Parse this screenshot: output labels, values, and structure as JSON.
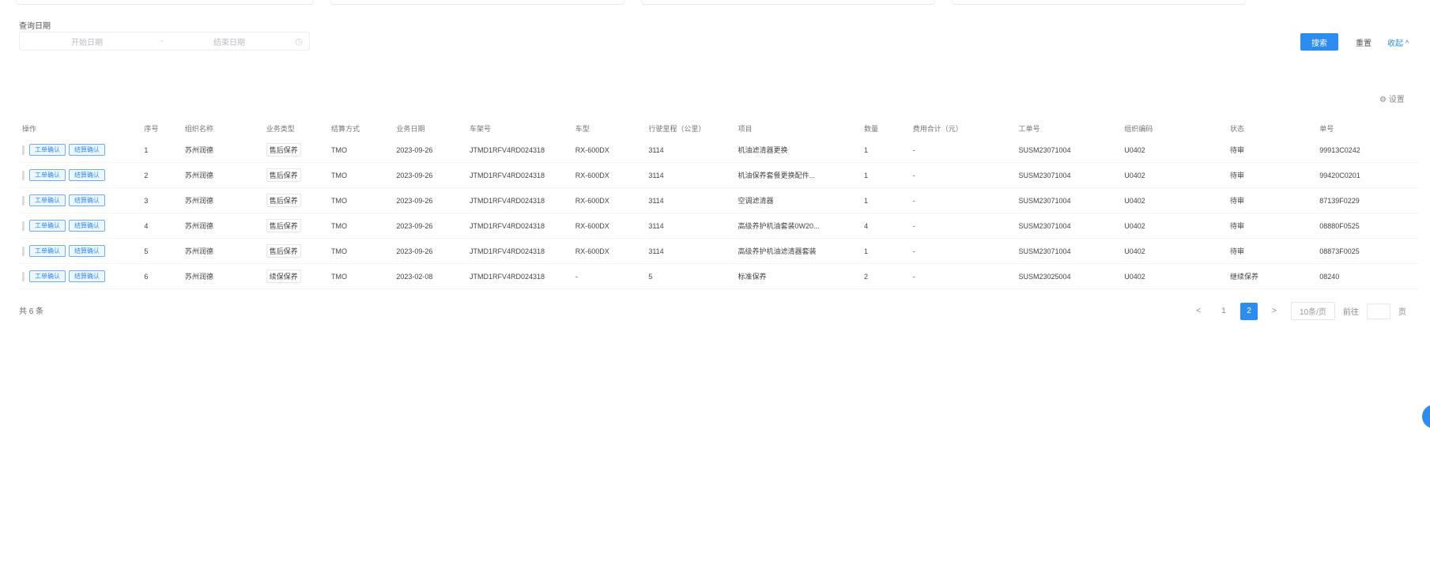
{
  "filters": {
    "date_label": "查询日期",
    "start_placeholder": "开始日期",
    "separator": "-",
    "end_placeholder": "结束日期",
    "search_label": "搜索",
    "reset_label": "重置",
    "collapse_label": "收起 ^"
  },
  "toolbar": {
    "settings_label": "⚙ 设置"
  },
  "table": {
    "headers": [
      "操作",
      "序号",
      "组织名称",
      "业务类型",
      "结算方式",
      "业务日期",
      "车架号",
      "车型",
      "行驶里程（公里）",
      "项目",
      "数量",
      "费用合计（元）",
      "工单号",
      "组织编码",
      "状态",
      "单号",
      ""
    ],
    "row_action_1": "工单确认",
    "row_action_2": "结算确认",
    "rows": [
      [
        "1",
        "苏州润德",
        "售后保养",
        "TMO",
        "2023-09-26",
        "JTMD1RFV4RD024318",
        "RX-600DX",
        "3114",
        "机油滤清器更换",
        "1",
        "-",
        "SUSM23071004",
        "U0402",
        "待审",
        "99913C0242",
        ""
      ],
      [
        "2",
        "苏州润德",
        "售后保养",
        "TMO",
        "2023-09-26",
        "JTMD1RFV4RD024318",
        "RX-600DX",
        "3114",
        "机油保养套餐更换配件...",
        "1",
        "-",
        "SUSM23071004",
        "U0402",
        "待审",
        "99420C0201",
        ""
      ],
      [
        "3",
        "苏州润德",
        "售后保养",
        "TMO",
        "2023-09-26",
        "JTMD1RFV4RD024318",
        "RX-600DX",
        "3114",
        "空调滤清器",
        "1",
        "-",
        "SUSM23071004",
        "U0402",
        "待审",
        "87139F0229",
        ""
      ],
      [
        "4",
        "苏州润德",
        "售后保养",
        "TMO",
        "2023-09-26",
        "JTMD1RFV4RD024318",
        "RX-600DX",
        "3114",
        "高级养护机油套装0W20...",
        "4",
        "-",
        "SUSM23071004",
        "U0402",
        "待审",
        "08880F0525",
        ""
      ],
      [
        "5",
        "苏州润德",
        "售后保养",
        "TMO",
        "2023-09-26",
        "JTMD1RFV4RD024318",
        "RX-600DX",
        "3114",
        "高级养护机油滤清器套装",
        "1",
        "-",
        "SUSM23071004",
        "U0402",
        "待审",
        "08873F0025",
        ""
      ],
      [
        "6",
        "苏州润德",
        "续保保养",
        "TMO",
        "2023-02-08",
        "JTMD1RFV4RD024318",
        "-",
        "5",
        "标准保养",
        "2",
        "-",
        "SUSM23025004",
        "U0402",
        "继续保养",
        "08240",
        ""
      ]
    ]
  },
  "pagination": {
    "total": "共 6 条",
    "prev": "<",
    "page_1": "1",
    "page_2": "2",
    "next": ">",
    "page_size": "10条/页",
    "goto_label": "前往",
    "page_suffix": "页"
  }
}
